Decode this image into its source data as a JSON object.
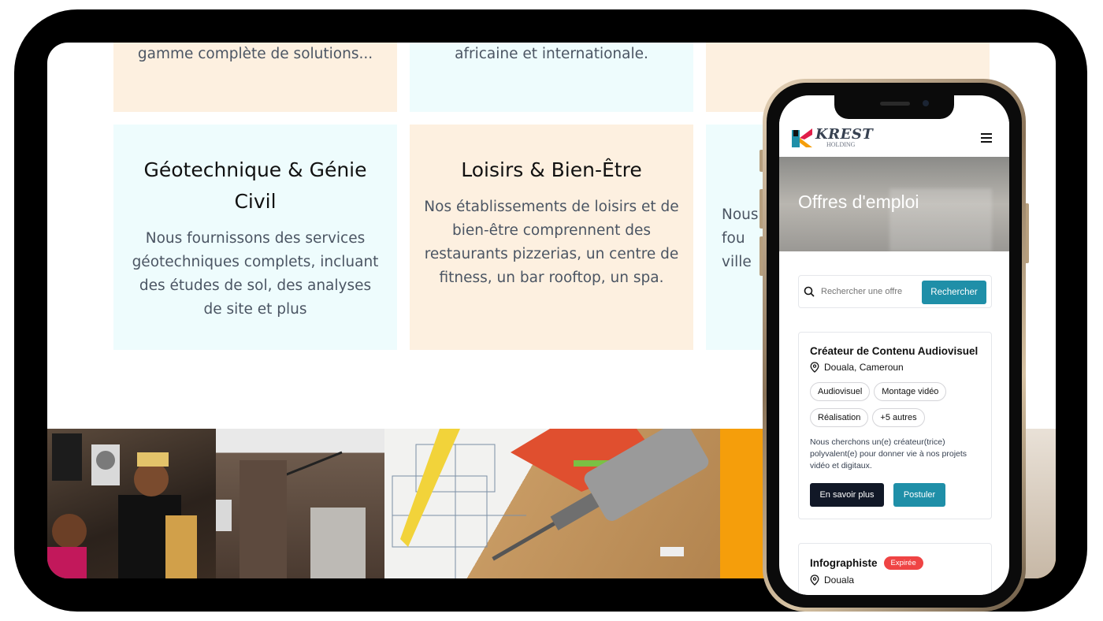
{
  "website": {
    "cards_top_row": [
      {
        "text": "gamme complète de solutions..."
      },
      {
        "text": "africaine et internationale."
      },
      {
        "text": ""
      }
    ],
    "cards": [
      {
        "title": "Géotechnique & Génie Civil",
        "text": "Nous fournissons des services géotechniques complets, incluant des études de sol, des analyses de site et plus"
      },
      {
        "title": "Loisirs & Bien-Être",
        "text": "Nos établissements de loisirs et de bien-être comprennent des restaurants pizzerias, un centre de fitness, un bar rooftop, un spa."
      },
      {
        "title": "",
        "text": "Nous fou ville"
      }
    ],
    "photos": [
      "people-event-photo",
      "kitchen-interior-photo",
      "blueprint-tools-photo",
      "orange-panel",
      "building-photo"
    ]
  },
  "phone": {
    "logo_main": "KREST",
    "logo_sub": "HOLDING",
    "hero_title": "Offres d'emploi",
    "search": {
      "placeholder": "Rechercher une offre",
      "button": "Rechercher"
    },
    "jobs": [
      {
        "title": "Créateur de Contenu Audiovisuel",
        "location": "Douala, Cameroun",
        "tags": [
          "Audiovisuel",
          "Montage vidéo",
          "Réalisation",
          "+5 autres"
        ],
        "description": "Nous cherchons un(e) créateur(trice) polyvalent(e) pour donner vie à nos projets vidéo et digitaux.",
        "btn_more": "En savoir plus",
        "btn_apply": "Postuler"
      },
      {
        "title": "Infographiste",
        "badge": "Expirée",
        "location": "Douala"
      }
    ],
    "colors": {
      "accent": "#1f8fa8",
      "dark": "#111827",
      "expired": "#ef4444"
    }
  }
}
